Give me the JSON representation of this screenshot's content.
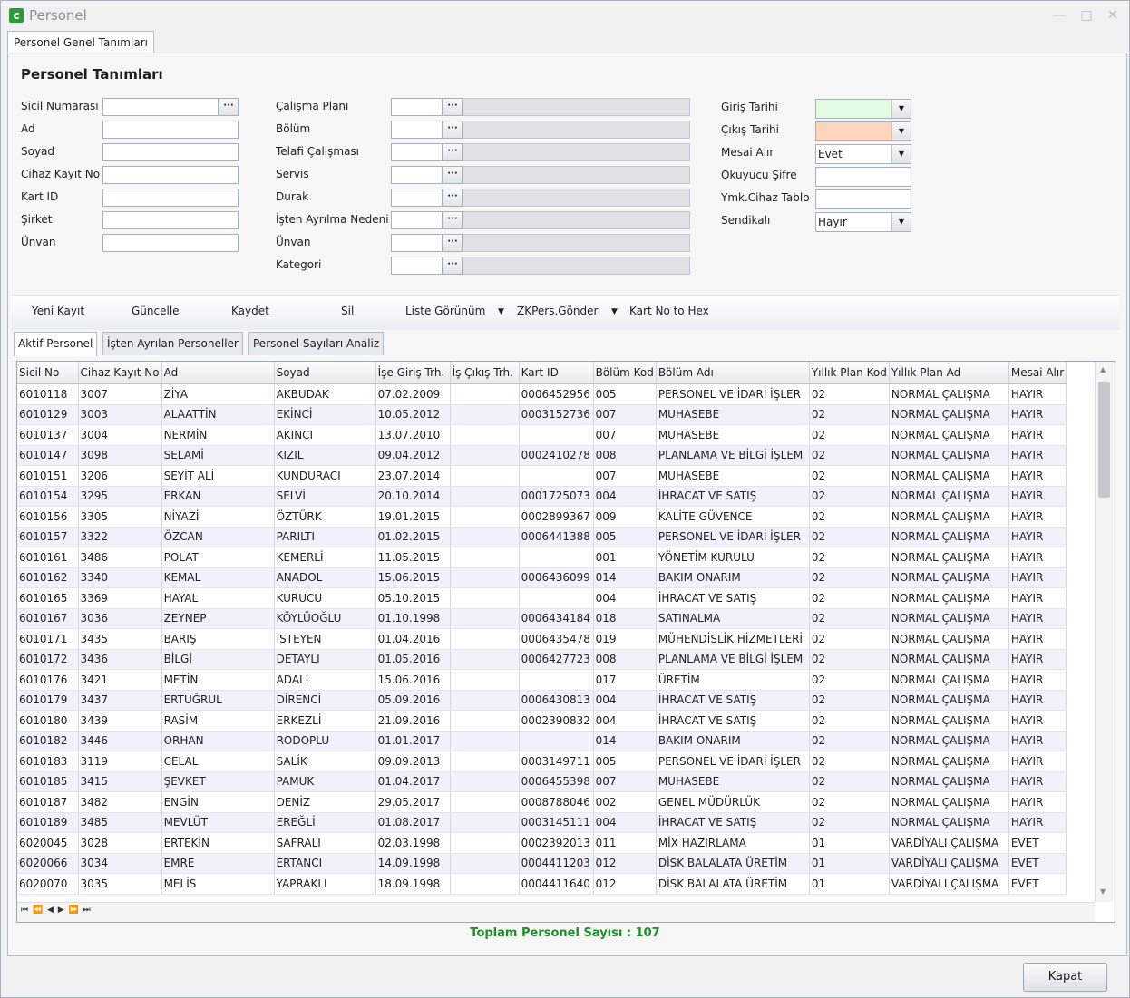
{
  "window": {
    "title": "Personel",
    "app_icon": "c"
  },
  "top_tab": "Personel Genel Tanımları",
  "section_title": "Personel Tanımları",
  "form": {
    "col1": [
      "Sicil Numarası",
      "Ad",
      "Soyad",
      "Cihaz Kayıt No",
      "Kart ID",
      "Şirket",
      "Ünvan"
    ],
    "col2": [
      "Çalışma Planı",
      "Bölüm",
      "Telafi Çalışması",
      "Servis",
      "Durak",
      "İşten Ayrılma Nedeni",
      "Ünvan",
      "Kategori"
    ],
    "col3": [
      "Giriş Tarihi",
      "Çıkış Tarihi",
      "Mesai Alır",
      "Okuyucu Şifre",
      "Ymk.Cihaz Tablo",
      "Sendikalı"
    ],
    "mesai_value": "Evet",
    "sendikali_value": "Hayır",
    "giris_color": "#e4fbe3",
    "cikis_color": "#fdd4bd"
  },
  "toolbar": {
    "yeni_kayit": "Yeni Kayıt",
    "guncelle": "Güncelle",
    "kaydet": "Kaydet",
    "sil": "Sil",
    "liste_gorunum": "Liste Görünüm",
    "zkpers": "ZKPers.Gönder",
    "kartno": "Kart No to Hex"
  },
  "tabs": [
    "Aktif Personel",
    "İşten Ayrılan Personeller",
    "Personel Sayıları Analiz"
  ],
  "columns": [
    "Sicil No",
    "Cihaz Kayıt No",
    "Ad",
    "Soyad",
    "İşe Giriş Trh.",
    "İş Çıkış Trh.",
    "Kart ID",
    "Bölüm Kod",
    "Bölüm Adı",
    "Yıllık Plan Kod",
    "Yıllık Plan Ad",
    "Mesai Alır"
  ],
  "rows": [
    [
      "6010118",
      "3007",
      "ZİYA",
      "AKBUDAK",
      "07.02.2009",
      "",
      "0006452956",
      "005",
      "PERSONEL VE İDARİ İŞLER",
      "02",
      "NORMAL ÇALIŞMA",
      "HAYIR"
    ],
    [
      "6010129",
      "3003",
      "ALAATTİN",
      "EKİNCİ",
      "10.05.2012",
      "",
      "0003152736",
      "007",
      "MUHASEBE",
      "02",
      "NORMAL ÇALIŞMA",
      "HAYIR"
    ],
    [
      "6010137",
      "3004",
      "NERMİN",
      "AKINCI",
      "13.07.2010",
      "",
      "",
      "007",
      "MUHASEBE",
      "02",
      "NORMAL ÇALIŞMA",
      "HAYIR"
    ],
    [
      "6010147",
      "3098",
      "SELAMİ",
      "KIZIL",
      "09.04.2012",
      "",
      "0002410278",
      "008",
      "PLANLAMA VE BİLGİ İŞLEM",
      "02",
      "NORMAL ÇALIŞMA",
      "HAYIR"
    ],
    [
      "6010151",
      "3206",
      "SEYİT ALİ",
      "KUNDURACI",
      "23.07.2014",
      "",
      "",
      "007",
      "MUHASEBE",
      "02",
      "NORMAL ÇALIŞMA",
      "HAYIR"
    ],
    [
      "6010154",
      "3295",
      "ERKAN",
      "SELVİ",
      "20.10.2014",
      "",
      "0001725073",
      "004",
      "İHRACAT VE SATIŞ",
      "02",
      "NORMAL ÇALIŞMA",
      "HAYIR"
    ],
    [
      "6010156",
      "3305",
      "NİYAZİ",
      "ÖZTÜRK",
      "19.01.2015",
      "",
      "0002899367",
      "009",
      "KALİTE GÜVENCE",
      "02",
      "NORMAL ÇALIŞMA",
      "HAYIR"
    ],
    [
      "6010157",
      "3322",
      "ÖZCAN",
      "PARILTI",
      "01.02.2015",
      "",
      "0006441388",
      "005",
      "PERSONEL VE İDARİ İŞLER",
      "02",
      "NORMAL ÇALIŞMA",
      "HAYIR"
    ],
    [
      "6010161",
      "3486",
      "POLAT",
      "KEMERLİ",
      "11.05.2015",
      "",
      "",
      "001",
      "YÖNETİM KURULU",
      "02",
      "NORMAL ÇALIŞMA",
      "HAYIR"
    ],
    [
      "6010162",
      "3340",
      "KEMAL",
      "ANADOL",
      "15.06.2015",
      "",
      "0006436099",
      "014",
      "BAKIM ONARIM",
      "02",
      "NORMAL ÇALIŞMA",
      "HAYIR"
    ],
    [
      "6010165",
      "3369",
      "HAYAL",
      "KURUCU",
      "05.10.2015",
      "",
      "",
      "004",
      "İHRACAT VE SATIŞ",
      "02",
      "NORMAL ÇALIŞMA",
      "HAYIR"
    ],
    [
      "6010167",
      "3036",
      "ZEYNEP",
      "KÖYLÜOĞLU",
      "01.10.1998",
      "",
      "0006434184",
      "018",
      "SATINALMA",
      "02",
      "NORMAL ÇALIŞMA",
      "HAYIR"
    ],
    [
      "6010171",
      "3435",
      "BARIŞ",
      "İSTEYEN",
      "01.04.2016",
      "",
      "0006435478",
      "019",
      "MÜHENDİSLİK HİZMETLERİ",
      "02",
      "NORMAL ÇALIŞMA",
      "HAYIR"
    ],
    [
      "6010172",
      "3436",
      "BİLGİ",
      "DETAYLI",
      "01.05.2016",
      "",
      "0006427723",
      "008",
      "PLANLAMA VE BİLGİ İŞLEM",
      "02",
      "NORMAL ÇALIŞMA",
      "HAYIR"
    ],
    [
      "6010176",
      "3421",
      "METİN",
      "ADALI",
      "15.06.2016",
      "",
      "",
      "017",
      "ÜRETİM",
      "02",
      "NORMAL ÇALIŞMA",
      "HAYIR"
    ],
    [
      "6010179",
      "3437",
      "ERTUĞRUL",
      "DİRENCİ",
      "05.09.2016",
      "",
      "0006430813",
      "004",
      "İHRACAT VE SATIŞ",
      "02",
      "NORMAL ÇALIŞMA",
      "HAYIR"
    ],
    [
      "6010180",
      "3439",
      "RASİM",
      "ERKEZLİ",
      "21.09.2016",
      "",
      "0002390832",
      "004",
      "İHRACAT VE SATIŞ",
      "02",
      "NORMAL ÇALIŞMA",
      "HAYIR"
    ],
    [
      "6010182",
      "3446",
      "ORHAN",
      "RODOPLU",
      "01.01.2017",
      "",
      "",
      "014",
      "BAKIM ONARIM",
      "02",
      "NORMAL ÇALIŞMA",
      "HAYIR"
    ],
    [
      "6010183",
      "3119",
      "CELAL",
      "SALİK",
      "09.09.2013",
      "",
      "0003149711",
      "005",
      "PERSONEL VE İDARİ İŞLER",
      "02",
      "NORMAL ÇALIŞMA",
      "HAYIR"
    ],
    [
      "6010185",
      "3415",
      "ŞEVKET",
      "PAMUK",
      "01.04.2017",
      "",
      "0006455398",
      "007",
      "MUHASEBE",
      "02",
      "NORMAL ÇALIŞMA",
      "HAYIR"
    ],
    [
      "6010187",
      "3482",
      "ENGİN",
      "DENİZ",
      "29.05.2017",
      "",
      "0008788046",
      "002",
      "GENEL MÜDÜRLÜK",
      "02",
      "NORMAL ÇALIŞMA",
      "HAYIR"
    ],
    [
      "6010189",
      "3485",
      "MEVLÜT",
      "EREĞLİ",
      "01.08.2017",
      "",
      "0003145111",
      "004",
      "İHRACAT VE SATIŞ",
      "02",
      "NORMAL ÇALIŞMA",
      "HAYIR"
    ],
    [
      "6020045",
      "3028",
      "ERTEKİN",
      "SAFRALI",
      "02.03.1998",
      "",
      "0002392013",
      "011",
      "MİX HAZIRLAMA",
      "01",
      "VARDİYALI ÇALIŞMA",
      "EVET"
    ],
    [
      "6020066",
      "3034",
      "EMRE",
      "ERTANCI",
      "14.09.1998",
      "",
      "0004411203",
      "012",
      "DİSK BALALATA ÜRETİM",
      "01",
      "VARDİYALI ÇALIŞMA",
      "EVET"
    ],
    [
      "6020070",
      "3035",
      "MELİS",
      "YAPRAKLI",
      "18.09.1998",
      "",
      "0004411640",
      "012",
      "DİSK BALALATA ÜRETİM",
      "01",
      "VARDİYALI ÇALIŞMA",
      "EVET"
    ]
  ],
  "total_label": "Toplam Personel Sayısı : 107",
  "close_button": "Kapat"
}
